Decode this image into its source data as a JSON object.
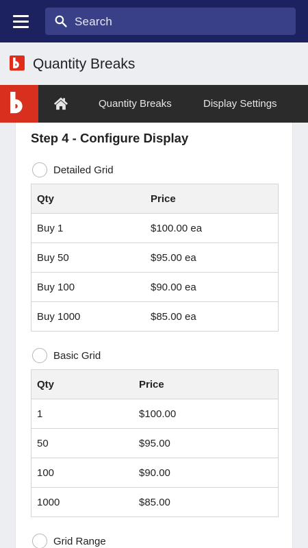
{
  "search": {
    "placeholder": "Search"
  },
  "app": {
    "title": "Quantity Breaks"
  },
  "nav": {
    "links": [
      "Quantity Breaks",
      "Display Settings"
    ]
  },
  "step": {
    "heading": "Step 4 - Configure Display"
  },
  "options": [
    {
      "label": "Detailed Grid",
      "selected": false,
      "columns": [
        "Qty",
        "Price"
      ],
      "rows": [
        [
          "Buy 1",
          "$100.00 ea"
        ],
        [
          "Buy 50",
          "$95.00 ea"
        ],
        [
          "Buy 100",
          "$90.00 ea"
        ],
        [
          "Buy 1000",
          "$85.00 ea"
        ]
      ]
    },
    {
      "label": "Basic Grid",
      "selected": false,
      "columns": [
        "Qty",
        "Price"
      ],
      "rows": [
        [
          "1",
          "$100.00"
        ],
        [
          "50",
          "$95.00"
        ],
        [
          "100",
          "$90.00"
        ],
        [
          "1000",
          "$85.00"
        ]
      ]
    },
    {
      "label": "Grid Range",
      "selected": false
    }
  ],
  "icons": {
    "menu": "hamburger-menu-icon",
    "search": "search-icon",
    "home": "home-icon",
    "logo": "app-logo-icon"
  },
  "colors": {
    "topbar": "#1c2260",
    "search_box": "#3a4088",
    "navbar": "#2b2b2b",
    "brand_red": "#d7301f"
  }
}
